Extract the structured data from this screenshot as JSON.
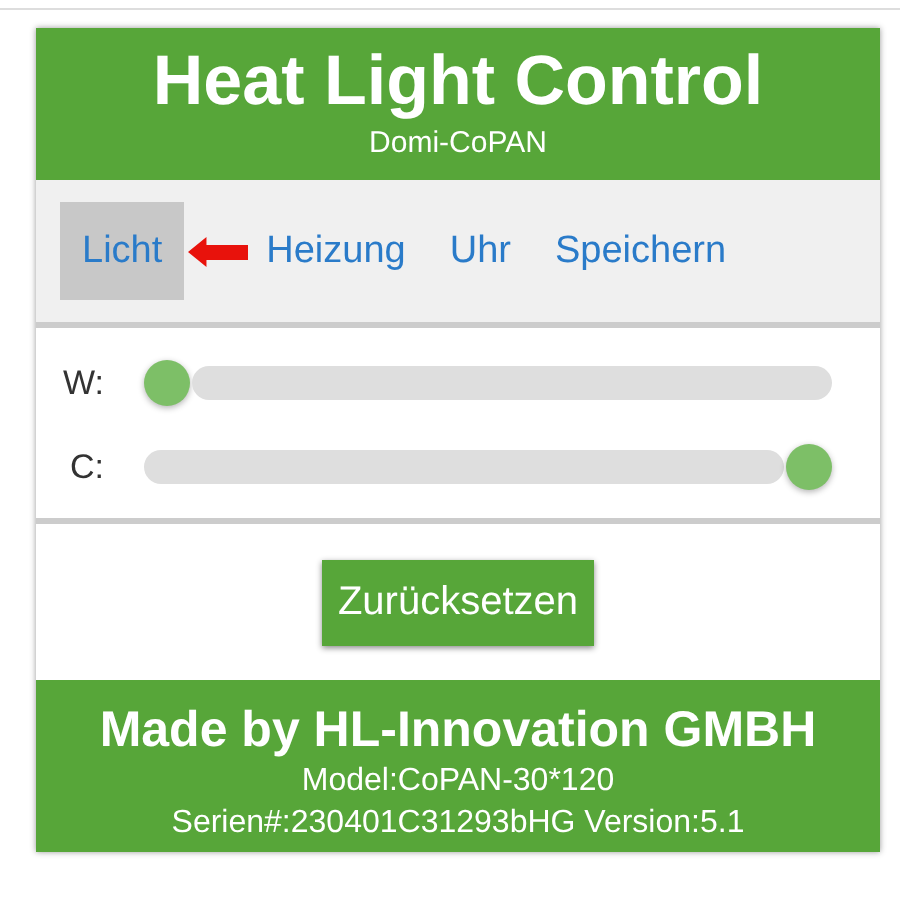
{
  "header": {
    "title": "Heat Light Control",
    "subtitle": "Domi-CoPAN"
  },
  "tabs": [
    {
      "label": "Licht",
      "selected": true
    },
    {
      "label": "Heizung",
      "selected": false
    },
    {
      "label": "Uhr",
      "selected": false
    },
    {
      "label": "Speichern",
      "selected": false
    }
  ],
  "sliders": [
    {
      "label": "W:",
      "level": 0
    },
    {
      "label": "C:",
      "level": 1
    }
  ],
  "reset_button": "Zurücksetzen",
  "footer": {
    "title": "Made by HL-Innovation GMBH",
    "model": "Model:CoPAN-30*120",
    "serial": "Serien#:230401C31293bHG Version:5.1"
  }
}
